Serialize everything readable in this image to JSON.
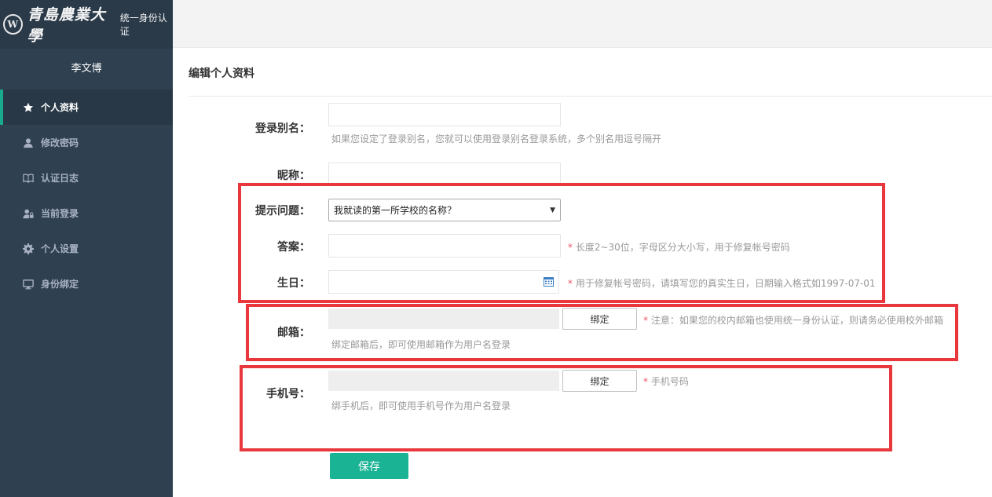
{
  "brand": {
    "logo_text": "W",
    "name": "青島農業大學",
    "subtitle": "统一身份认证"
  },
  "user": {
    "name": "李文博"
  },
  "nav": {
    "items": [
      {
        "label": "个人资料",
        "icon": "star-icon",
        "active": true
      },
      {
        "label": "修改密码",
        "icon": "user-icon"
      },
      {
        "label": "认证日志",
        "icon": "book-icon"
      },
      {
        "label": "当前登录",
        "icon": "user-lock-icon"
      },
      {
        "label": "个人设置",
        "icon": "gear-icon"
      },
      {
        "label": "身份绑定",
        "icon": "monitor-icon"
      }
    ]
  },
  "page": {
    "title": "编辑个人资料"
  },
  "form": {
    "alias": {
      "label": "登录别名：",
      "value": "",
      "help": "如果您设定了登录别名，您就可以使用登录别名登录系统，多个别名用逗号隔开"
    },
    "nickname": {
      "label": "昵称：",
      "value": ""
    },
    "question": {
      "label": "提示问题：",
      "selected": "我就读的第一所学校的名称？"
    },
    "answer": {
      "label": "答案：",
      "value": "",
      "required": "*",
      "help": "长度2~30位，字母区分大小写，用于修复帐号密码"
    },
    "birthday": {
      "label": "生日：",
      "value": "",
      "required": "*",
      "help": "用于修复帐号密码，请填写您的真实生日，日期输入格式如1997-07-01"
    },
    "email": {
      "label": "邮箱：",
      "value": "",
      "button": "绑定",
      "required": "*",
      "note": "注意：如果您的校内邮箱也使用统一身份认证，则请务必使用校外邮箱",
      "help": "绑定邮箱后，即可使用邮箱作为用户名登录"
    },
    "phone": {
      "label": "手机号：",
      "value": "",
      "button": "绑定",
      "required": "*",
      "note": "手机号码",
      "help": "绑手机后，即可使用手机号作为用户名登录"
    },
    "save_label": "保存"
  },
  "colors": {
    "sidebar_bg": "#2f4050",
    "accent": "#1ab394",
    "highlight": "#e8383d",
    "required": "#ed5565"
  }
}
